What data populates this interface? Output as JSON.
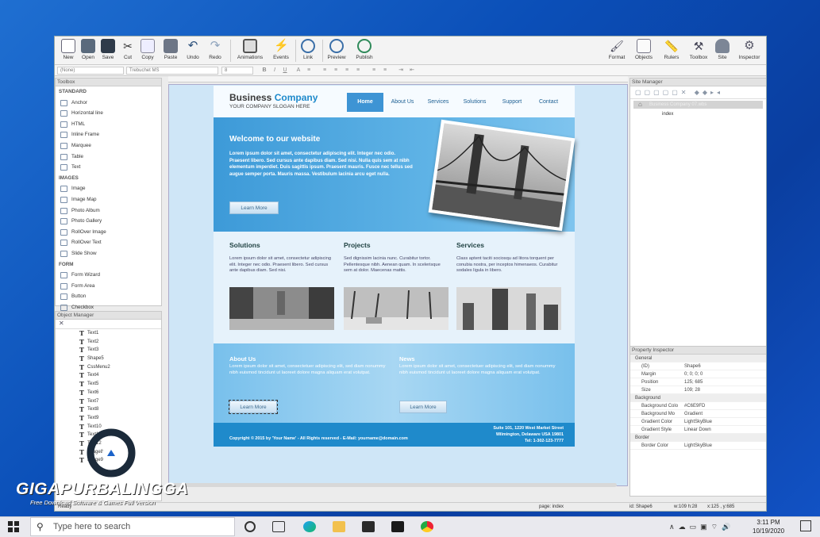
{
  "toolbar": {
    "new": "New",
    "open": "Open",
    "save": "Save",
    "cut": "Cut",
    "copy": "Copy",
    "paste": "Paste",
    "undo": "Undo",
    "redo": "Redo",
    "animations": "Animations",
    "events": "Events",
    "link": "Link",
    "preview": "Preview",
    "publish": "Publish",
    "format": "Format",
    "objects": "Objects",
    "rulers": "Rulers",
    "toolbox": "Toolbox",
    "site": "Site",
    "inspector": "Inspector"
  },
  "formatbar": {
    "style": "(None)",
    "font": "Trebuchet MS",
    "size": "8"
  },
  "toolbox": {
    "title": "Toolbox",
    "items": [
      {
        "label": "STANDARD",
        "cat": true
      },
      {
        "label": "Anchor"
      },
      {
        "label": "Horizontal line"
      },
      {
        "label": "HTML"
      },
      {
        "label": "Inline Frame"
      },
      {
        "label": "Marquee"
      },
      {
        "label": "Table"
      },
      {
        "label": "Text"
      },
      {
        "label": "IMAGES",
        "cat": true
      },
      {
        "label": "Image"
      },
      {
        "label": "Image Map"
      },
      {
        "label": "Photo Album"
      },
      {
        "label": "Photo Gallery"
      },
      {
        "label": "RollOver Image"
      },
      {
        "label": "RollOver Text"
      },
      {
        "label": "Slide Show"
      },
      {
        "label": "FORM",
        "cat": true
      },
      {
        "label": "Form Wizard"
      },
      {
        "label": "Form Area"
      },
      {
        "label": "Button"
      },
      {
        "label": "Checkbox"
      }
    ]
  },
  "objectmanager": {
    "title": "Object Manager",
    "items": [
      "Text1",
      "Text2",
      "Text3",
      "Shape5",
      "CssMenu2",
      "Text4",
      "Text5",
      "Text6",
      "Text7",
      "Text8",
      "Text9",
      "Text10",
      "Text11",
      "Text12",
      "Image8",
      "Image9"
    ]
  },
  "site": {
    "brand1": "Business ",
    "brand2": "Company",
    "slogan": "YOUR COMPANY SLOGAN HERE",
    "nav": [
      "Home",
      "About Us",
      "Services",
      "Solutions",
      "Support",
      "Contact"
    ],
    "hero_title": "Welcome to our website",
    "hero_text": "Lorem ipsum dolor sit amet, consectetur adipiscing elit. Integer nec odio. Praesent libero. Sed cursus ante dapibus diam. Sed nisi. Nulla quis sem at nibh elementum imperdiet. Duis sagittis ipsum. Praesent mauris. Fusce nec tellus sed augue semper porta. Mauris massa. Vestibulum lacinia arcu eget nulla.",
    "learn_more": "Learn More",
    "col1_title": "Solutions",
    "col1_text": "Lorem ipsum dolor sit amet, consectetur adipiscing elit. Integer nec odio. Praesent libero. Sed cursus ante dapibus diam. Sed nisi.",
    "col2_title": "Projects",
    "col2_text": "Sed dignissim lacinia nunc. Curabitur tortor. Pellentesque nibh. Aenean quam. In scelerisque sem at dolor. Maecenas mattis.",
    "col3_title": "Services",
    "col3_text": "Class aptent taciti sociosqu ad litora torquent per conubia nostra, per inceptos himenaeos. Curabitur sodales ligula in libero.",
    "about_title": "About Us",
    "about_text": "Lorem ipsum dolor sit amet, consectetuer adipiscing elit, sed diam nonummy nibh euismod tincidunt ut laoreet dolore magna aliquam erat volutpat.",
    "news_title": "News",
    "news_text": "Lorem ipsum dolor sit amet, consectetuer adipiscing elit, sed diam nonummy nibh euismod tincidunt ut laoreet dolore magna aliquam erat volutpat.",
    "footer_left": "Copyright © 2015 by 'Your Name' - All Rights reserved - E-Mail: yourname@domain.com",
    "addr1": "Suite 101, 1220 West Market Street",
    "addr2": "Wilmington, Delaware USA 19801",
    "addr3": "Tel: 1-302-123-7777"
  },
  "sitemanager": {
    "title": "Site Manager",
    "root": "Business Company 07.wbs",
    "page": "index"
  },
  "propinspector": {
    "title": "Property Inspector",
    "rows": [
      {
        "k": "General",
        "cat": true
      },
      {
        "k": "(ID)",
        "v": "Shape6"
      },
      {
        "k": "Margin",
        "v": "0; 0; 0; 0"
      },
      {
        "k": "Position",
        "v": "125; 685"
      },
      {
        "k": "Size",
        "v": "109; 28"
      },
      {
        "k": "Background",
        "cat": true
      },
      {
        "k": "Background Colo",
        "v": "#C6E9FD"
      },
      {
        "k": "Background Mo",
        "v": "Gradient"
      },
      {
        "k": "Gradient Color",
        "v": "LightSkyBlue"
      },
      {
        "k": "Gradient Style",
        "v": "Linear Down"
      },
      {
        "k": "Border",
        "cat": true
      },
      {
        "k": "Border Color",
        "v": "LightSkyBlue"
      }
    ]
  },
  "status": {
    "left": "Ready",
    "page": "page: index",
    "id": "id: Shape6",
    "wh": "w:109 h:28",
    "xy": "x:125 , y:685"
  },
  "taskbar": {
    "search": "Type here to search",
    "time": "3:11 PM",
    "date": "10/19/2020"
  },
  "watermark": {
    "title": "GIGAPURBALINGGA",
    "tagline": "Free Download Software & Games Full Version"
  },
  "colors": {
    "accent": "#1f8acb",
    "nav_active": "#3e94d4"
  }
}
